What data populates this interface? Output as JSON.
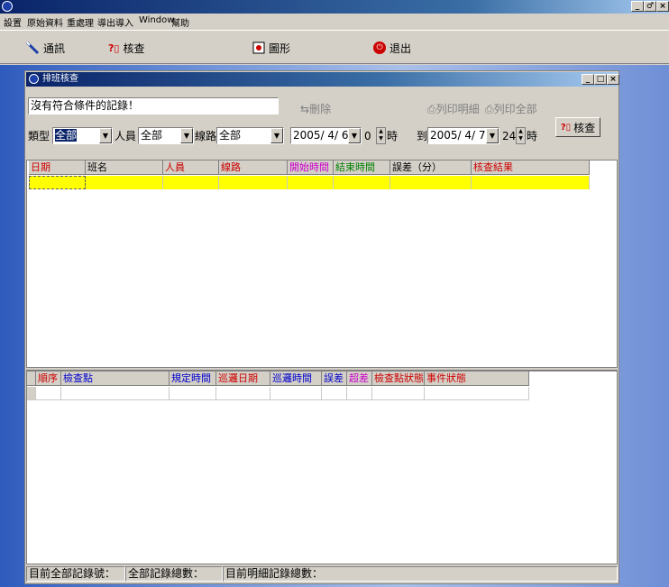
{
  "app": {
    "menus": [
      "設置",
      "原始資料",
      "重處理",
      "導出導入",
      "Window",
      "幫助"
    ],
    "window_buttons": [
      "_",
      "♂",
      "×"
    ]
  },
  "toolbar": {
    "comm": "通訊",
    "check": "核查",
    "graph": "圖形",
    "exit": "退出"
  },
  "window": {
    "title": "排班核查",
    "buttons": [
      "_",
      "□",
      "×"
    ]
  },
  "filters": {
    "message": "沒有符合條件的記錄！",
    "delete": "刪除",
    "print_detail": "列印明細",
    "print_all": "列印全部",
    "check": "核查",
    "type_label": "類型",
    "type_value": "全部",
    "person_label": "人員",
    "person_value": "全部",
    "route_label": "線路",
    "route_value": "全部",
    "from_date": "2005/ 4/ 6",
    "from_hour": "0",
    "hour_label": "時",
    "to_label": "到",
    "to_date": "2005/ 4/ 7",
    "to_hour": "24",
    "hour_label2": "時"
  },
  "grid1": {
    "headers": [
      {
        "label": "日期",
        "color": "#cc0000"
      },
      {
        "label": "班名",
        "color": "#000000"
      },
      {
        "label": "人員",
        "color": "#cc0000"
      },
      {
        "label": "線路",
        "color": "#cc0000"
      },
      {
        "label": "開始時間",
        "color": "#cc00cc"
      },
      {
        "label": "結束時間",
        "color": "#008000"
      },
      {
        "label": "誤差（分）",
        "color": "#000000"
      },
      {
        "label": "核查結果",
        "color": "#cc0000"
      }
    ]
  },
  "grid2": {
    "headers": [
      {
        "label": "順序",
        "color": "#cc0000"
      },
      {
        "label": "檢查點",
        "color": "#0000cc"
      },
      {
        "label": "規定時間",
        "color": "#0000cc"
      },
      {
        "label": "巡邏日期",
        "color": "#cc0000"
      },
      {
        "label": "巡邏時間",
        "color": "#0000cc"
      },
      {
        "label": "誤差",
        "color": "#0000cc"
      },
      {
        "label": "超差",
        "color": "#cc00cc"
      },
      {
        "label": "檢查點狀態",
        "color": "#cc0000"
      },
      {
        "label": "事件狀態",
        "color": "#cc0000"
      }
    ]
  },
  "status": {
    "current_all": "目前全部記錄號：",
    "total_all": "全部記錄總數：",
    "total_detail": "目前明細記錄總數："
  }
}
